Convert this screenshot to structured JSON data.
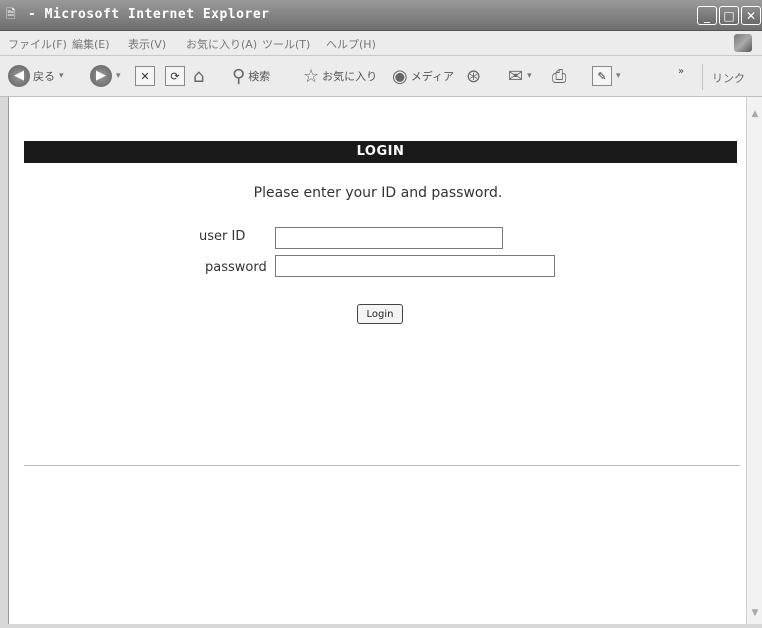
{
  "window": {
    "title": " - Microsoft Internet Explorer",
    "app_icon": "ie-page-icon"
  },
  "menu": {
    "items": [
      "ファイル(F)",
      "編集(E)",
      "表示(V)",
      "お気に入り(A)",
      "ツール(T)",
      "ヘルプ(H)"
    ]
  },
  "toolbar": {
    "back_label": "戻る",
    "search_label": "検索",
    "favorites_label": "お気に入り",
    "media_label": "メディア",
    "links_label": "リンク",
    "more_chevron": "»"
  },
  "page": {
    "header": "LOGIN",
    "instruction": "Please enter your ID and password.",
    "user_id_label": "user ID",
    "user_id_value": "",
    "password_label": "password",
    "password_value": "",
    "login_button": "Login"
  }
}
